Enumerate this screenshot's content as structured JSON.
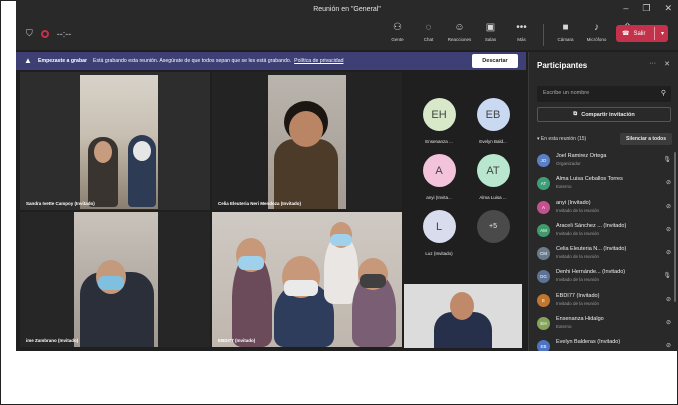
{
  "window": {
    "title": "Reunión en \"General\"",
    "controls": [
      "–",
      "❐",
      "✕"
    ]
  },
  "toolbar": {
    "timer": "--:--",
    "items": [
      {
        "icon": "people-icon",
        "glyph": "⚇",
        "label": "Gente"
      },
      {
        "icon": "chat-icon",
        "glyph": "◌",
        "label": "Chat"
      },
      {
        "icon": "reactions-icon",
        "glyph": "☺",
        "label": "Reacciones"
      },
      {
        "icon": "rooms-icon",
        "glyph": "▣",
        "label": "Salas"
      },
      {
        "icon": "more-icon",
        "glyph": "•••",
        "label": "Más"
      }
    ],
    "devices": [
      {
        "icon": "camera-icon",
        "glyph": "■",
        "label": "Cámara"
      },
      {
        "icon": "microphone-icon",
        "glyph": "♪",
        "label": "Micrófono"
      },
      {
        "icon": "share-icon",
        "glyph": "⇧",
        "label": "Comparte"
      }
    ],
    "leave_label": "Salir"
  },
  "banner": {
    "title": "Empezaste a grabar",
    "text": "Está grabando esta reunión. Asegúrate de que todos sepan que se les está grabando.",
    "link": "Política de privacidad",
    "dismiss": "Descartar"
  },
  "videos": {
    "tile1": "Sandra Ivette Campoy (Invitado)",
    "tile2": "Celia Eleuteria Neri Mendoza (Invitado)",
    "tile3": "ime Zambrano (Invitado)",
    "tile4": "EBDI77 (Invitado)"
  },
  "avatars": [
    {
      "initials": "EH",
      "label": "Ensenanza ...",
      "color": "#d7e9c9"
    },
    {
      "initials": "EB",
      "label": "Evelyn Bald...",
      "color": "#c9d9f1"
    },
    {
      "initials": "A",
      "label": "anyi (Invita...",
      "color": "#f3c3dc"
    },
    {
      "initials": "AT",
      "label": "Alma Luisa ...",
      "color": "#b9e6cf"
    },
    {
      "initials": "L",
      "label": "Luz (Invitado)",
      "color": "#d9dcec"
    },
    {
      "initials": "+5",
      "label": "",
      "color": "#4a4a4a"
    }
  ],
  "panel": {
    "title": "Participantes",
    "search_placeholder": "Escribe un nombre",
    "share_invite": "Compartir invitación",
    "in_meeting": "En esta reunión (15)",
    "mute_all": "Silenciar a todos",
    "participants": [
      {
        "initials": "JO",
        "name": "Joel Ramirez Ortega",
        "role": "Organizador",
        "color": "#5a7fc7",
        "mic": "on"
      },
      {
        "initials": "AT",
        "name": "Alma Luisa Ceballos Torres",
        "role": "Externo",
        "color": "#3e9e7a",
        "mic": "off"
      },
      {
        "initials": "A",
        "name": "anyi (Invitado)",
        "role": "Invitado de la reunión",
        "color": "#c2528e",
        "mic": "off"
      },
      {
        "initials": "AM",
        "name": "Araceli Sánchez ... (Invitado)",
        "role": "Invitado de la reunión",
        "color": "#3f9a6c",
        "mic": "off"
      },
      {
        "initials": "CM",
        "name": "Celia Eleuteria N... (Invitado)",
        "role": "Invitado de la reunión",
        "color": "#6b7b8c",
        "mic": "off"
      },
      {
        "initials": "DG",
        "name": "Denhi Hernánde... (Invitado)",
        "role": "Invitado de la reunión",
        "color": "#5d7295",
        "mic": "on"
      },
      {
        "initials": "E",
        "name": "EBDI77 (Invitado)",
        "role": "Invitado de la reunión",
        "color": "#c0772d",
        "mic": "off"
      },
      {
        "initials": "EH",
        "name": "Ensenanza Hidalgo",
        "role": "Externo",
        "color": "#86a35a",
        "mic": "off"
      },
      {
        "initials": "EB",
        "name": "Evelyn Balderas (Invitado)",
        "role": "",
        "color": "#4d74c4",
        "mic": "off"
      }
    ]
  },
  "colors": {
    "accent": "#c4314b",
    "banner": "#3e3f74",
    "panel": "#292929"
  }
}
